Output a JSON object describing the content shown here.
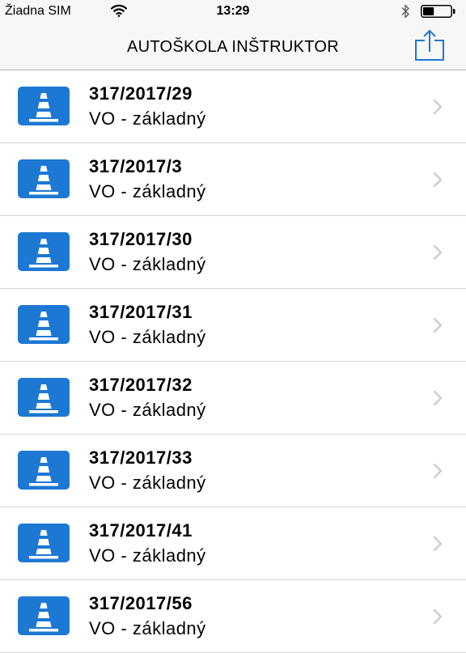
{
  "status_bar": {
    "carrier": "Žiadna SIM",
    "time": "13:29",
    "wifi_icon": "wifi-icon",
    "bluetooth_icon": "bluetooth-icon",
    "battery_icon": "battery-icon",
    "battery_level": 0.4
  },
  "nav_bar": {
    "title": "AUTOŠKOLA INŠTRUKTOR",
    "share_icon": "share-icon"
  },
  "colors": {
    "accent": "#1c78d3",
    "chevron": "#c7c7cc",
    "separator": "#d5d5d5",
    "bar_background": "#f7f7f7"
  },
  "list": {
    "item_icon": "traffic-cone-icon",
    "items": [
      {
        "title": "317/2017/29",
        "subtitle": "VO - základný"
      },
      {
        "title": "317/2017/3",
        "subtitle": "VO - základný"
      },
      {
        "title": "317/2017/30",
        "subtitle": "VO - základný"
      },
      {
        "title": "317/2017/31",
        "subtitle": "VO - základný"
      },
      {
        "title": "317/2017/32",
        "subtitle": "VO - základný"
      },
      {
        "title": "317/2017/33",
        "subtitle": "VO - základný"
      },
      {
        "title": "317/2017/41",
        "subtitle": "VO - základný"
      },
      {
        "title": "317/2017/56",
        "subtitle": "VO - základný"
      }
    ]
  }
}
